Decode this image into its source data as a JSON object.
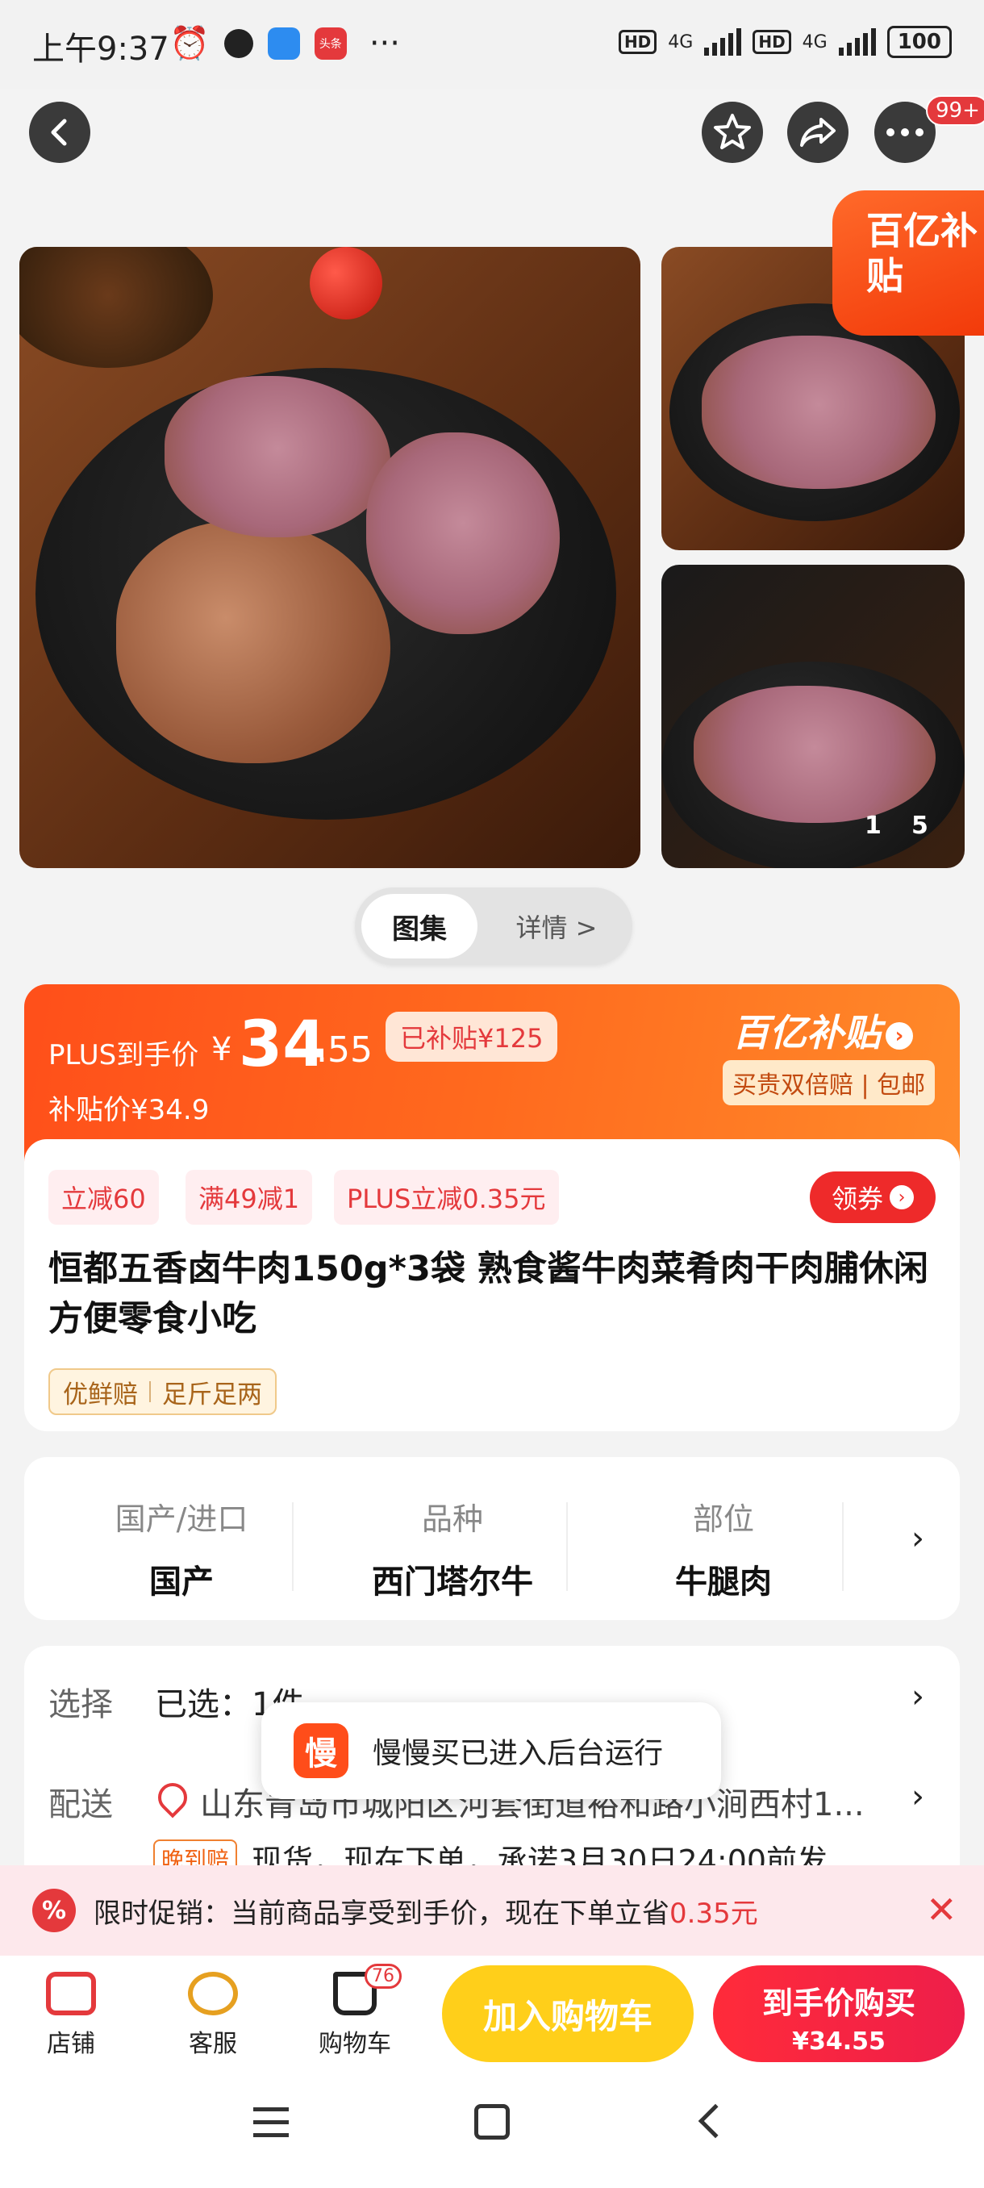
{
  "status_bar": {
    "time": "上午9:37",
    "news_icon_text": "头条",
    "more": "···",
    "network1": "4G",
    "network2": "4G",
    "hd": "HD",
    "battery": "100"
  },
  "top_nav": {
    "badge": "99+"
  },
  "gallery": {
    "subsidy_tag": "百亿补贴",
    "counter_current": "1",
    "counter_total": "5"
  },
  "segment": {
    "active": "图集",
    "inactive": "详情 >"
  },
  "price_card": {
    "plus_label": "PLUS到手价",
    "currency": "¥",
    "price_int": "34",
    "price_dec": ".55",
    "subsidized": "已补贴¥125",
    "subsidy_price": "补贴价¥34.9",
    "logo": "百亿补贴",
    "double": "买贵双倍赔 | 包邮"
  },
  "info": {
    "coupons": [
      "立减60",
      "满49减1",
      "PLUS立减0.35元"
    ],
    "get_coupon": "领券",
    "title": "恒都五香卤牛肉150g*3袋 熟食酱牛肉菜肴肉干肉脯休闲方便零食小吃",
    "guarantee1": "优鲜赔",
    "guarantee2": "足斤足两"
  },
  "attributes": [
    {
      "key": "国产/进口",
      "value": "国产"
    },
    {
      "key": "品种",
      "value": "西门塔尔牛"
    },
    {
      "key": "部位",
      "value": "牛腿肉"
    }
  ],
  "selection": {
    "select_label": "选择",
    "select_value": "已选：1件",
    "delivery_label": "配送",
    "delivery_address": "山东青岛市城阳区河套街道裕和路小涧西村1...",
    "late_tag": "晚到赔",
    "delivery_note": "现货，现在下单，承诺3月30日24:00前发"
  },
  "toast": {
    "app_icon_text": "慢",
    "message": "慢慢买已进入后台运行"
  },
  "promo": {
    "text_prefix": "限时促销：当前商品享受到手价，现在下单立省",
    "amount": "0.35元",
    "close": "✕"
  },
  "bottom_bar": {
    "store": "店铺",
    "service": "客服",
    "cart": "购物车",
    "cart_count": "76",
    "add_to_cart": "加入购物车",
    "buy_now": "到手价购买",
    "buy_price": "¥34.55"
  },
  "colors": {
    "accent": "#e4393c",
    "orange": "#ff5a1e",
    "yellow": "#ffcf1a"
  }
}
